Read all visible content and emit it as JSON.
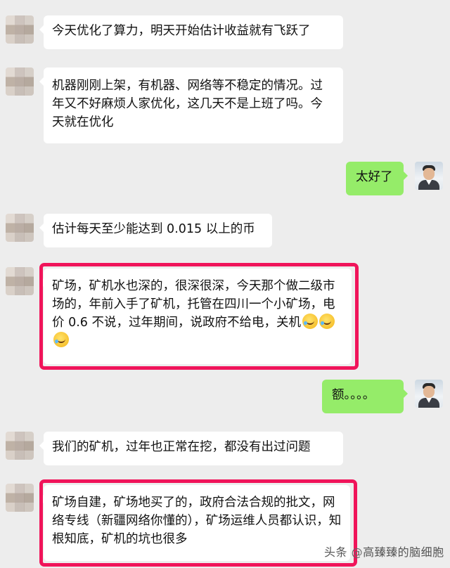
{
  "messages": [
    {
      "side": "left",
      "text": "今天优化了算力，明天开始估计收益就有飞跃了"
    },
    {
      "side": "left",
      "text": "机器刚刚上架，有机器、网络等不稳定的情况。过年又不好麻烦人家优化，这几天不是上班了吗。今天就在优化"
    },
    {
      "side": "right",
      "text": "太好了"
    },
    {
      "side": "left",
      "text": "估计每天至少能达到 0.015 以上的币"
    },
    {
      "side": "left",
      "text": "矿场，矿机水也深的，很深很深，今天那个做二级市场的，年前入手了矿机，托管在四川一个小矿场，电价 0.6 不说，过年期间，说政府不给电，关机",
      "emoji": [
        "crying-laughing-emoji",
        "crying-laughing-emoji",
        "crying-laughing-emoji"
      ],
      "highlighted": true
    },
    {
      "side": "right",
      "text": "额。。。。"
    },
    {
      "side": "left",
      "text": "我们的矿机，过年也正常在挖，都没有出过问题"
    },
    {
      "side": "left",
      "text": "矿场自建，矿场地买了的，政府合法合规的批文，网络专线（新疆网络你懂的），矿场运维人员都认识，知根知底，矿机的坑也很多",
      "highlighted": true
    }
  ],
  "watermark": {
    "prefix": "头条",
    "at": "@",
    "name": "高臻臻的脑细胞"
  },
  "colors": {
    "background": "#ededed",
    "bubble_left": "#ffffff",
    "bubble_right": "#95ec69",
    "highlight": "#f0145a"
  }
}
